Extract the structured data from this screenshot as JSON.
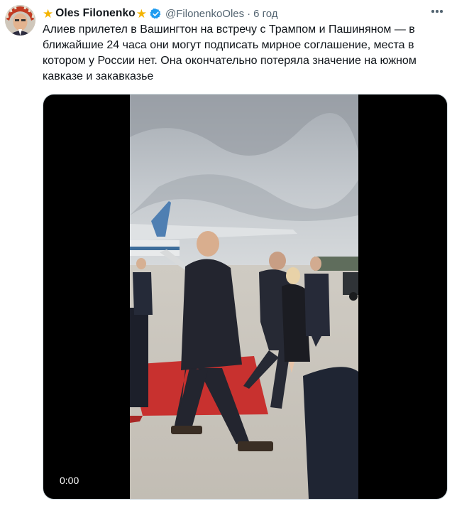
{
  "tweet": {
    "display_name": "Oles Filonenko",
    "handle": "@FilonenkoOles",
    "separator": "·",
    "time": "6 год",
    "text": "Алиев прилетел в Вашингтон на встречу с Трампом и Пашиняном — в ближайшие 24 часа они могут подписать мирное соглашение, места в котором у России нет. Она окончательно потеряла значение на южном кавказе и закавказье",
    "icons": {
      "name_decoration": "star-icon",
      "verified": "verified-badge-icon",
      "more": "more-options-icon"
    },
    "colors": {
      "star": "#f4b400",
      "verified": "#1d9bf0",
      "secondary_text": "#536471",
      "primary_text": "#0f1419"
    }
  },
  "media": {
    "type": "video",
    "timestamp": "0:00"
  }
}
